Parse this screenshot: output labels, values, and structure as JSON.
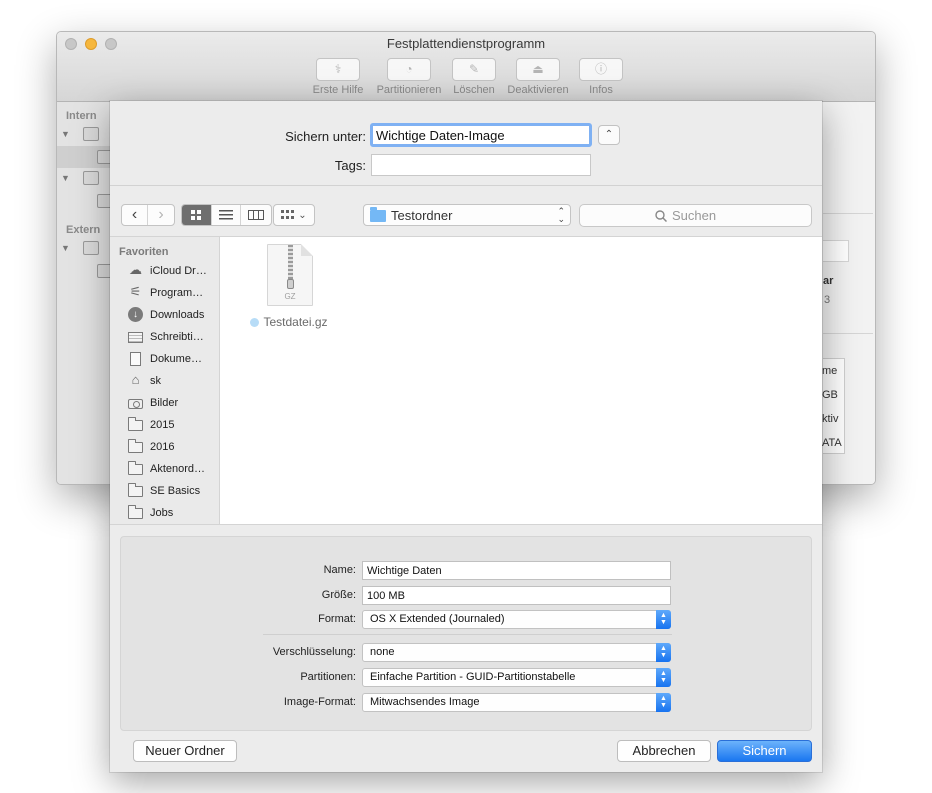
{
  "window": {
    "title": "Festplattendienstprogramm",
    "toolbar": [
      {
        "label": "Erste Hilfe",
        "icon": "stethoscope-icon",
        "glyph": "⚕"
      },
      {
        "label": "Partitionieren",
        "icon": "pie-chart-icon",
        "glyph": "◔"
      },
      {
        "label": "Löschen",
        "icon": "erase-icon",
        "glyph": "✎"
      },
      {
        "label": "Deaktivieren",
        "icon": "eject-icon",
        "glyph": "⏏"
      },
      {
        "label": "Infos",
        "icon": "info-icon",
        "glyph": "ⓘ"
      }
    ],
    "sidebar": {
      "intern_heading": "Intern",
      "extern_heading": "Extern"
    },
    "fragments": [
      "ar",
      "3",
      "me",
      "GB",
      "ktiv",
      "ATA"
    ]
  },
  "sheet": {
    "save_as_label": "Sichern unter:",
    "save_as_value": "Wichtige Daten-Image",
    "tags_label": "Tags:",
    "collapse_glyph": "⌃",
    "location": "Testordner",
    "search_placeholder": "Suchen",
    "favorites_heading": "Favoriten",
    "favorites": [
      {
        "label": "iCloud Dr…",
        "icon": "cloud-icon"
      },
      {
        "label": "Program…",
        "icon": "applications-icon"
      },
      {
        "label": "Downloads",
        "icon": "download-icon"
      },
      {
        "label": "Schreibti…",
        "icon": "desktop-icon"
      },
      {
        "label": "Dokume…",
        "icon": "documents-icon"
      },
      {
        "label": "sk",
        "icon": "home-icon"
      },
      {
        "label": "Bilder",
        "icon": "camera-icon"
      },
      {
        "label": "2015",
        "icon": "folder-icon"
      },
      {
        "label": "2016",
        "icon": "folder-icon"
      },
      {
        "label": "Aktenord…",
        "icon": "folder-icon"
      },
      {
        "label": "SE Basics",
        "icon": "folder-icon"
      },
      {
        "label": "Jobs",
        "icon": "folder-icon"
      }
    ],
    "file": {
      "name": "Testdatei.gz",
      "badge": "GZ",
      "tag_color": "#b7dcf7"
    },
    "options": {
      "name_label": "Name:",
      "name_value": "Wichtige Daten",
      "size_label": "Größe:",
      "size_value": "100 MB",
      "format_label": "Format:",
      "format_value": "OS X Extended (Journaled)",
      "encryption_label": "Verschlüsselung:",
      "encryption_value": "none",
      "partitions_label": "Partitionen:",
      "partitions_value": "Einfache Partition - GUID-Partitionstabelle",
      "image_format_label": "Image-Format:",
      "image_format_value": "Mitwachsendes Image"
    },
    "buttons": {
      "new_folder": "Neuer Ordner",
      "cancel": "Abbrechen",
      "save": "Sichern"
    }
  },
  "colors": {
    "accent": "#1a76f0",
    "traffic_minimize": "#f6b73d",
    "folder_blue": "#74b8f5"
  }
}
